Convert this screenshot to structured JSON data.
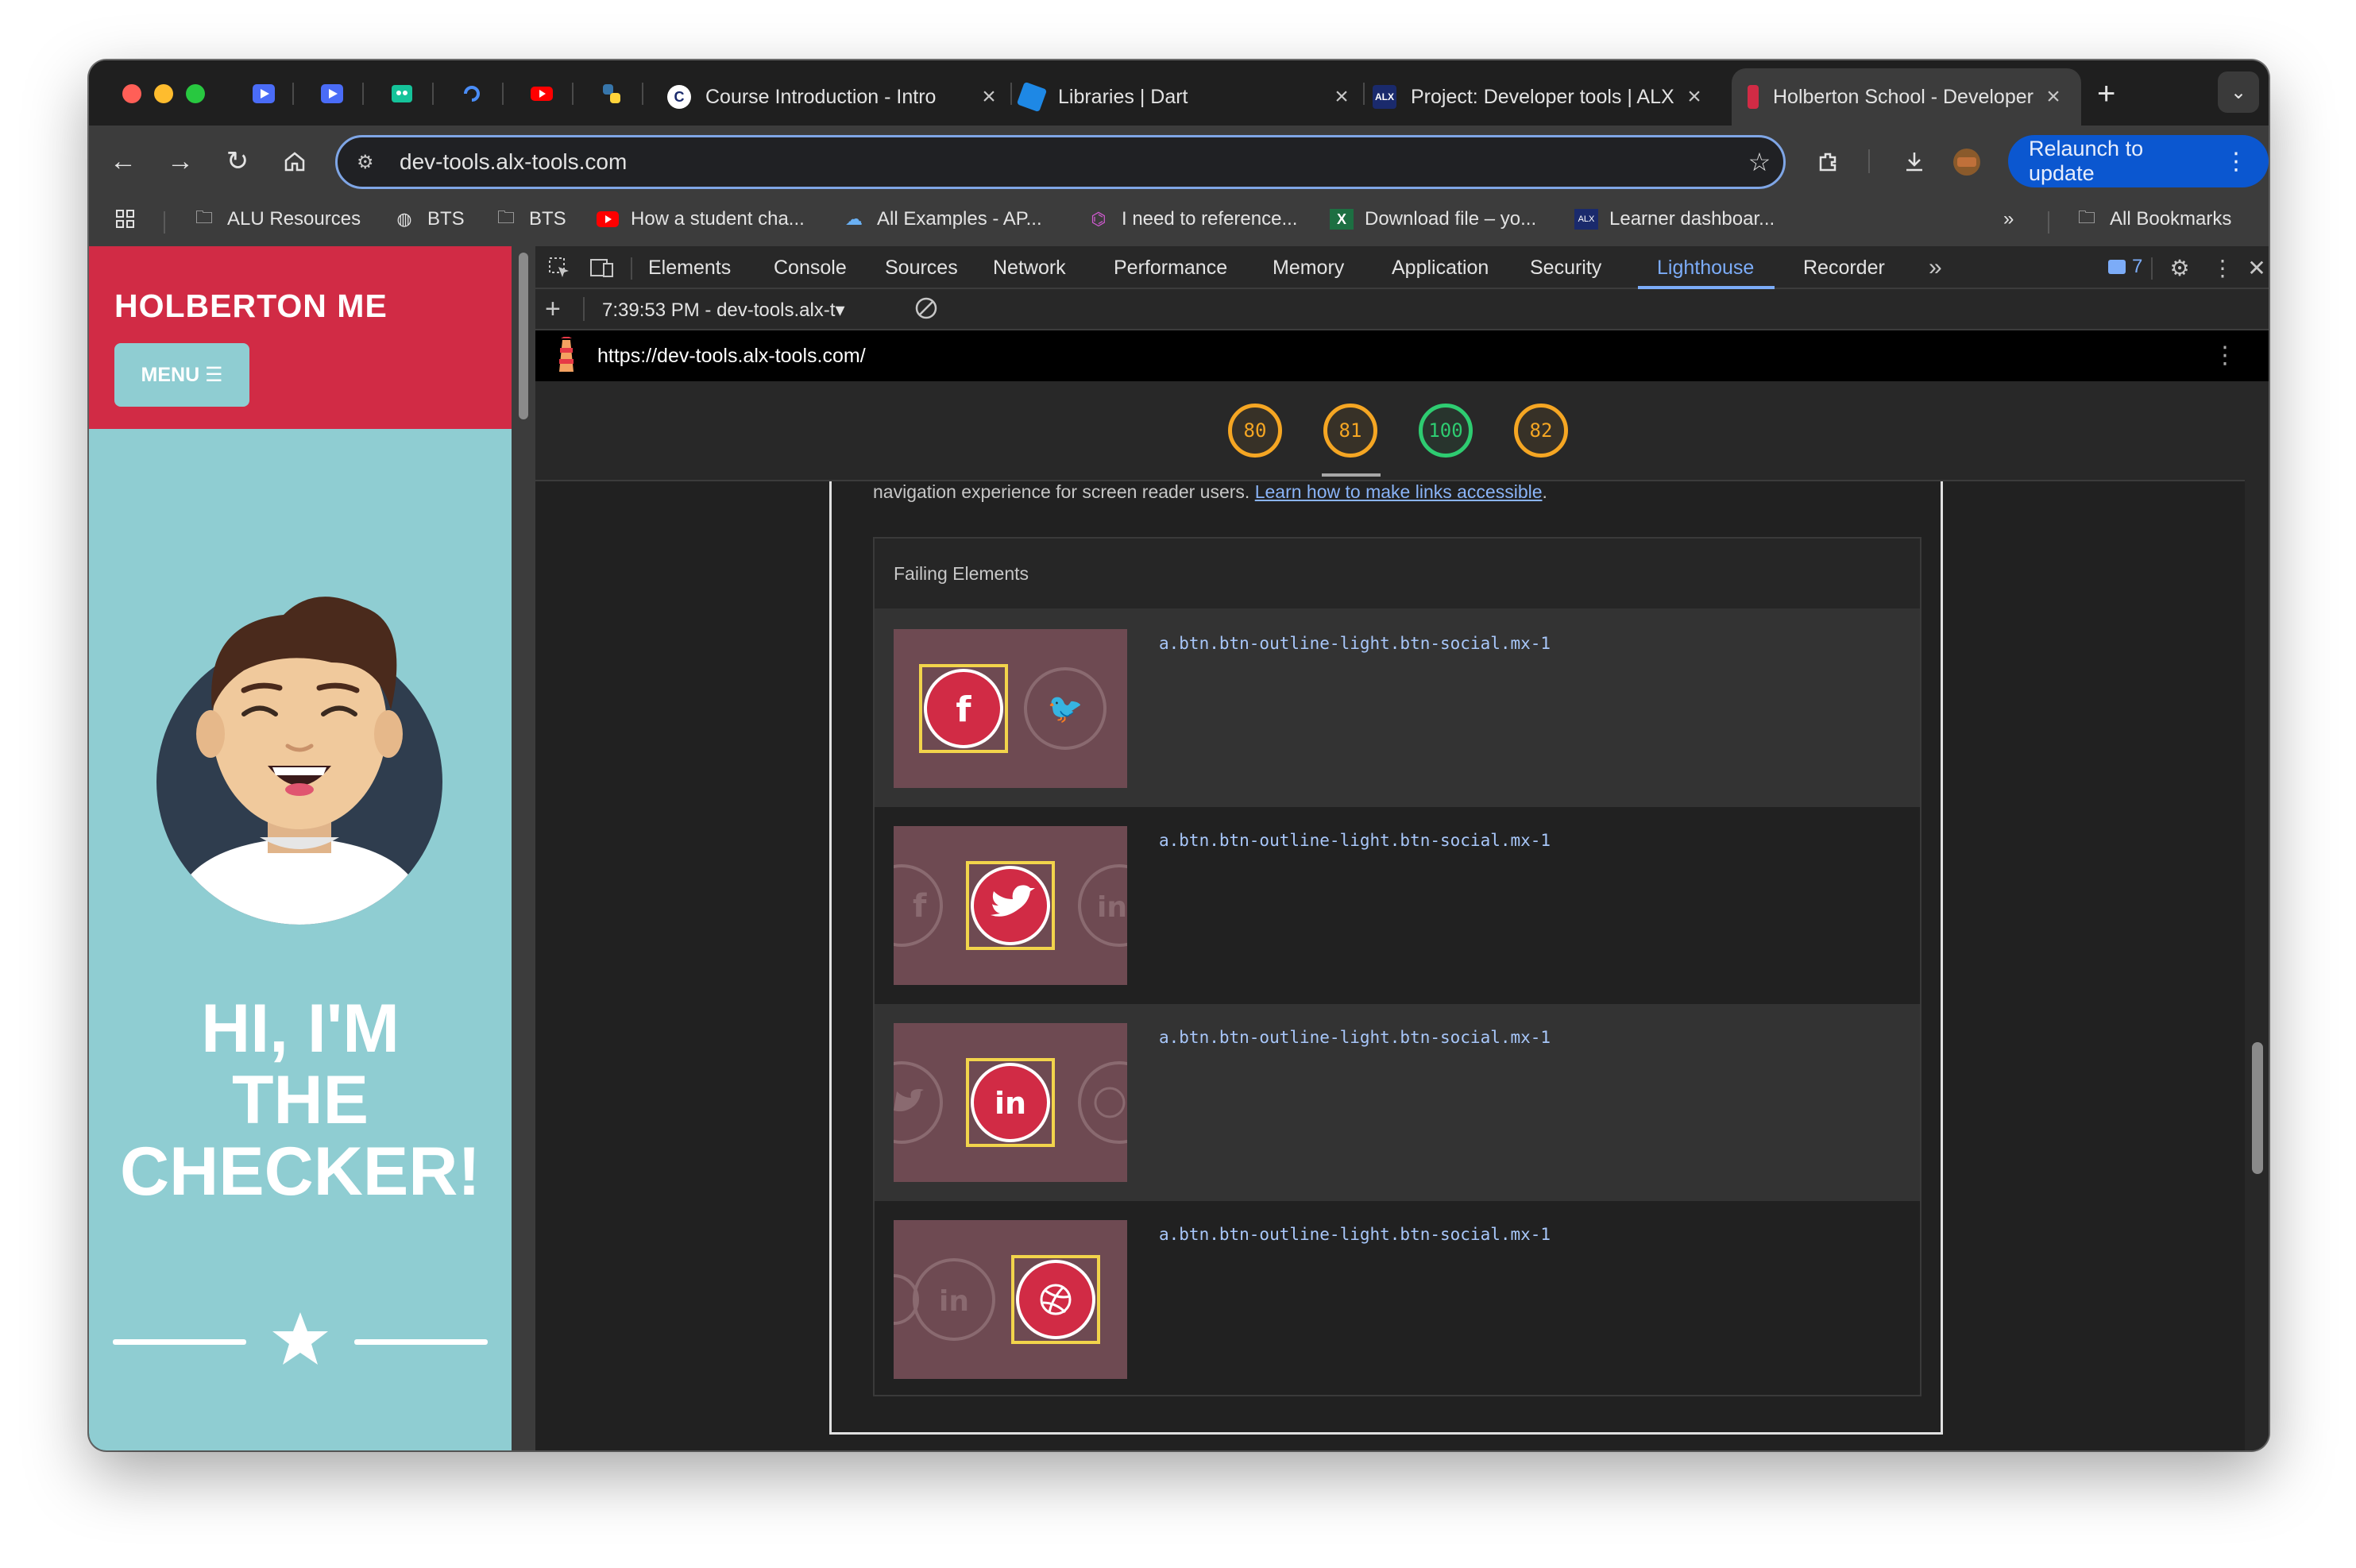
{
  "tabs": {
    "pinned": [
      {
        "icon": "video-play-icon",
        "color": "#4a6cf7"
      },
      {
        "icon": "video-play-icon",
        "color": "#4a6cf7"
      },
      {
        "icon": "grammarly-icon",
        "color": "#15c39a"
      },
      {
        "icon": "loop-icon",
        "color": "#1a73e8"
      },
      {
        "icon": "youtube-icon",
        "color": "#ff0000"
      },
      {
        "icon": "python-icon",
        "color": "#3776ab"
      }
    ],
    "open": [
      {
        "title": "Course Introduction - Intro",
        "fav": "C",
        "color": "#ffffff",
        "active": false
      },
      {
        "title": "Libraries | Dart",
        "fav": "",
        "color": "#1e88e5",
        "active": false
      },
      {
        "title": "Project: Developer tools | ALX",
        "fav": "",
        "color": "#1a2a6c",
        "active": false
      },
      {
        "title": "Holberton School - Developer",
        "fav": "",
        "color": "#d12b45",
        "active": true
      }
    ]
  },
  "toolbar": {
    "url": "dev-tools.alx-tools.com",
    "relaunch_label": "Relaunch to update"
  },
  "bookmarks": {
    "items": [
      {
        "label": "ALU Resources",
        "icon": "folder-icon"
      },
      {
        "label": "BTS",
        "icon": "globe-icon"
      },
      {
        "label": "BTS",
        "icon": "folder-icon"
      },
      {
        "label": "How a student cha...",
        "icon": "youtube-icon"
      },
      {
        "label": "All Examples - AP...",
        "icon": "cloud-icon"
      },
      {
        "label": "I need to reference...",
        "icon": "notion-icon"
      },
      {
        "label": "Download file – yo...",
        "icon": "excel-icon"
      },
      {
        "label": "Learner dashboar...",
        "icon": "alx-icon"
      }
    ],
    "all_label": "All Bookmarks"
  },
  "page": {
    "brand": "HOLBERTON ME",
    "menu_label": "MENU ☰",
    "hero_line1": "HI, I'M",
    "hero_line2": "THE",
    "hero_line3": "CHECKER!"
  },
  "devtools": {
    "tabs": [
      "Elements",
      "Console",
      "Sources",
      "Network",
      "Performance",
      "Memory",
      "Application",
      "Security",
      "Lighthouse",
      "Recorder"
    ],
    "active_tab": "Lighthouse",
    "issues_count": "7",
    "report_selector": "7:39:53 PM - dev-tools.alx-t▾",
    "report_url": "https://dev-tools.alx-tools.com/",
    "scores": [
      {
        "value": "80",
        "status": "orange"
      },
      {
        "value": "81",
        "status": "orange"
      },
      {
        "value": "100",
        "status": "green"
      },
      {
        "value": "82",
        "status": "orange"
      }
    ],
    "description_text": "navigation experience for screen reader users. ",
    "description_link": "Learn how to make links accessible",
    "description_end": ".",
    "failing_header": "Failing Elements",
    "failing": [
      {
        "selector": "a.btn.btn-outline-light.btn-social.mx-1",
        "highlight": "facebook-icon"
      },
      {
        "selector": "a.btn.btn-outline-light.btn-social.mx-1",
        "highlight": "twitter-icon"
      },
      {
        "selector": "a.btn.btn-outline-light.btn-social.mx-1",
        "highlight": "linkedin-icon"
      },
      {
        "selector": "a.btn.btn-outline-light.btn-social.mx-1",
        "highlight": "dribbble-icon"
      }
    ]
  },
  "colors": {
    "accent": "#d12b45",
    "page_bg": "#8fcdd2",
    "devtools_active": "#7cacf8",
    "score_orange": "#f5a623",
    "score_green": "#2ecc71"
  }
}
